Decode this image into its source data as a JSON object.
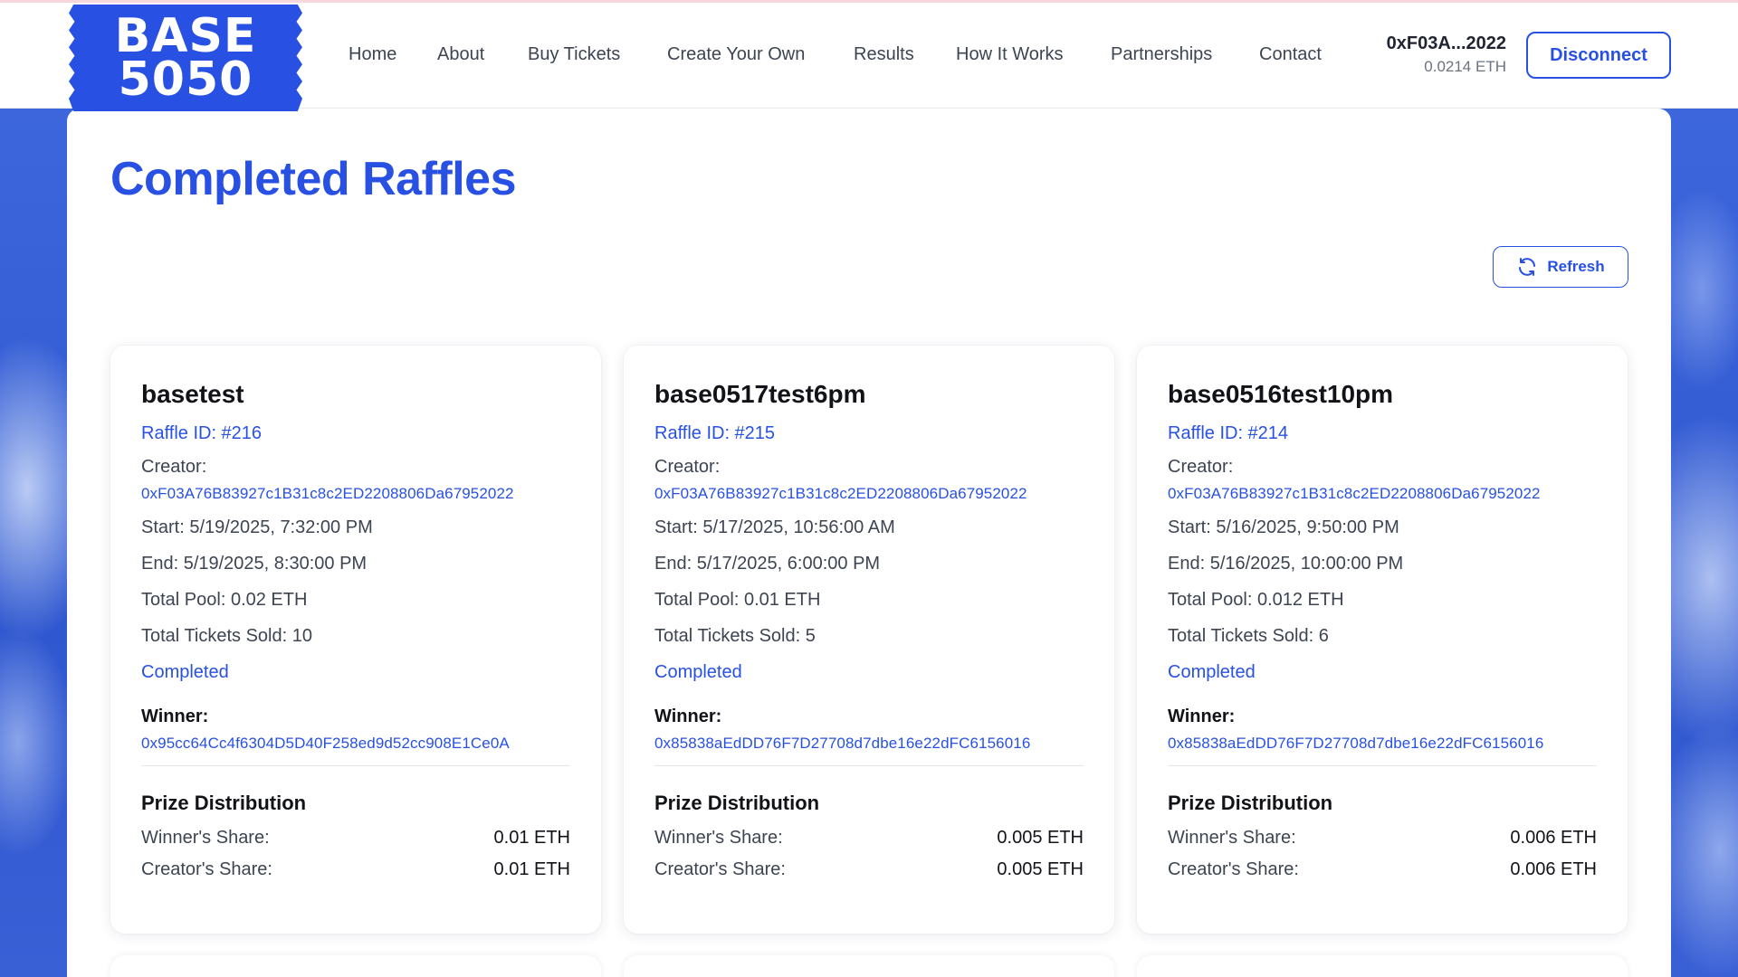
{
  "logo": {
    "line1": "BASE",
    "line2": "5050"
  },
  "nav": {
    "items": [
      "Home",
      "About",
      "Buy Tickets",
      "Create Your Own",
      "Results",
      "How It Works",
      "Partnerships",
      "Contact"
    ]
  },
  "wallet": {
    "address": "0xF03A...2022",
    "balance": "0.0214 ETH"
  },
  "header": {
    "disconnect_label": "Disconnect"
  },
  "page": {
    "title": "Completed Raffles",
    "refresh_label": "Refresh"
  },
  "labels": {
    "creator": "Creator:",
    "winner": "Winner:",
    "prize_distribution": "Prize Distribution",
    "winners_share": "Winner's Share:",
    "creators_share": "Creator's Share:"
  },
  "raffles": [
    {
      "name": "basetest",
      "raffle_id": "Raffle ID: #216",
      "creator": "0xF03A76B83927c1B31c8c2ED2208806Da67952022",
      "start": "Start: 5/19/2025, 7:32:00 PM",
      "end": "End: 5/19/2025, 8:30:00 PM",
      "total_pool": "Total Pool: 0.02 ETH",
      "tickets_sold": "Total Tickets Sold: 10",
      "status": "Completed",
      "winner": "0x95cc64Cc4f6304D5D40F258ed9d52cc908E1Ce0A",
      "winner_share": "0.01 ETH",
      "creator_share": "0.01 ETH"
    },
    {
      "name": "base0517test6pm",
      "raffle_id": "Raffle ID: #215",
      "creator": "0xF03A76B83927c1B31c8c2ED2208806Da67952022",
      "start": "Start: 5/17/2025, 10:56:00 AM",
      "end": "End: 5/17/2025, 6:00:00 PM",
      "total_pool": "Total Pool: 0.01 ETH",
      "tickets_sold": "Total Tickets Sold: 5",
      "status": "Completed",
      "winner": "0x85838aEdDD76F7D27708d7dbe16e22dFC6156016",
      "winner_share": "0.005 ETH",
      "creator_share": "0.005 ETH"
    },
    {
      "name": "base0516test10pm",
      "raffle_id": "Raffle ID: #214",
      "creator": "0xF03A76B83927c1B31c8c2ED2208806Da67952022",
      "start": "Start: 5/16/2025, 9:50:00 PM",
      "end": "End: 5/16/2025, 10:00:00 PM",
      "total_pool": "Total Pool: 0.012 ETH",
      "tickets_sold": "Total Tickets Sold: 6",
      "status": "Completed",
      "winner": "0x85838aEdDD76F7D27708d7dbe16e22dFC6156016",
      "winner_share": "0.006 ETH",
      "creator_share": "0.006 ETH"
    }
  ],
  "colors": {
    "brand": "#2851e3",
    "background": "#3b63d8",
    "text": "#3d4452",
    "heading": "#111318"
  }
}
